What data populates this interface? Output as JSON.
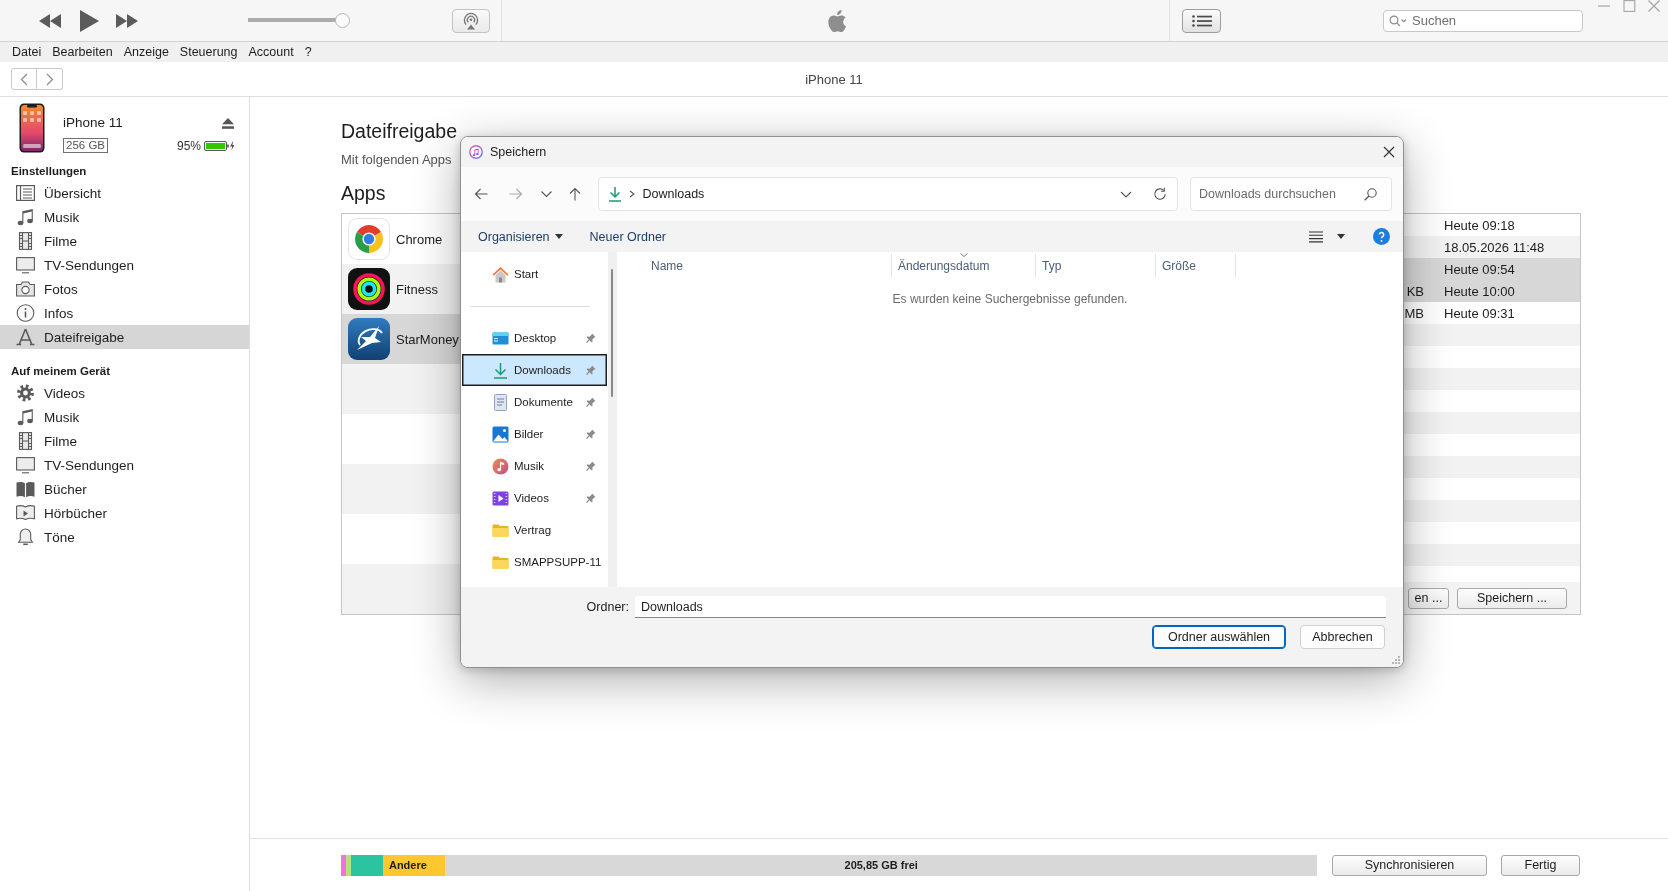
{
  "toolbar": {
    "volume": {
      "level": 0.94
    },
    "search": {
      "placeholder": "Suchen"
    }
  },
  "menu_bar": [
    "Datei",
    "Bearbeiten",
    "Anzeige",
    "Steuerung",
    "Account",
    "?"
  ],
  "nav_bar": {
    "title": "iPhone 11"
  },
  "device": {
    "name": "iPhone 11",
    "capacity": "256 GB",
    "battery": "95%"
  },
  "sidebar": {
    "sections": [
      {
        "heading": "Einstellungen",
        "items": [
          {
            "label": "Übersicht",
            "selected": false
          },
          {
            "label": "Musik",
            "selected": false
          },
          {
            "label": "Filme",
            "selected": false
          },
          {
            "label": "TV-Sendungen",
            "selected": false
          },
          {
            "label": "Fotos",
            "selected": false
          },
          {
            "label": "Infos",
            "selected": false
          },
          {
            "label": "Dateifreigabe",
            "selected": true
          }
        ]
      },
      {
        "heading": "Auf meinem Gerät",
        "items": [
          {
            "label": "Videos",
            "selected": false
          },
          {
            "label": "Musik",
            "selected": false
          },
          {
            "label": "Filme",
            "selected": false
          },
          {
            "label": "TV-Sendungen",
            "selected": false
          },
          {
            "label": "Bücher",
            "selected": false
          },
          {
            "label": "Hörbücher",
            "selected": false
          },
          {
            "label": "Töne",
            "selected": false
          }
        ]
      }
    ]
  },
  "file_sharing": {
    "title": "Dateifreigabe",
    "description": "Mit folgenden Apps",
    "apps_title": "Apps",
    "apps": [
      {
        "name": "Chrome",
        "selected": false
      },
      {
        "name": "Fitness",
        "selected": false
      },
      {
        "name": "StarMoney",
        "selected": true
      }
    ],
    "documents": [
      {
        "modified": "Heute 09:18",
        "selected": false
      },
      {
        "modified": "18.05.2026 11:48",
        "selected": false
      },
      {
        "modified": "Heute 09:54",
        "selected": true
      },
      {
        "size": "KB",
        "modified": "Heute 10:00",
        "selected": true
      },
      {
        "size": "MB",
        "modified": "Heute 09:31",
        "selected": false
      }
    ],
    "buttons": [
      "en ...",
      "Speichern ..."
    ]
  },
  "storage": {
    "segments": [
      {
        "color": "#f472de",
        "level": 0.005
      },
      {
        "color": "#b5e27d",
        "level": 0.005
      },
      {
        "color": "#2cc3a0",
        "level": 0.033
      },
      {
        "label": "Andere",
        "color": "#fdc82f",
        "level": 0.064
      }
    ],
    "free": "205,85 GB frei"
  },
  "footer_buttons": [
    "Synchronisieren",
    "Fertig"
  ],
  "dialog": {
    "title": "Speichern",
    "breadcrumb": "Downloads",
    "search": {
      "placeholder": "Downloads durchsuchen"
    },
    "commands": [
      {
        "label": "Organisieren",
        "kind": "menu"
      },
      {
        "label": "Neuer Ordner",
        "kind": "plain"
      }
    ],
    "nav_pane": {
      "groups": [
        {
          "items": [
            {
              "label": "Start",
              "pinned": false,
              "selected": false
            }
          ]
        },
        {
          "items": [
            {
              "label": "Desktop",
              "pinned": true,
              "selected": false
            },
            {
              "label": "Downloads",
              "pinned": true,
              "selected": true
            },
            {
              "label": "Dokumente",
              "pinned": true,
              "selected": false
            },
            {
              "label": "Bilder",
              "pinned": true,
              "selected": false
            },
            {
              "label": "Musik",
              "pinned": true,
              "selected": false
            },
            {
              "label": "Videos",
              "pinned": true,
              "selected": false
            },
            {
              "label": "Vertrag",
              "pinned": false,
              "selected": false
            },
            {
              "label": "SMAPPSUPP-11",
              "pinned": false,
              "selected": false
            }
          ]
        }
      ]
    },
    "columns": [
      {
        "label": "Name",
        "sorted": false
      },
      {
        "label": "Änderungsdatum",
        "sorted": true
      },
      {
        "label": "Typ",
        "sorted": false
      },
      {
        "label": "Größe",
        "sorted": false
      }
    ],
    "empty_message": "Es wurden keine Suchergebnisse gefunden.",
    "folder": {
      "label": "Ordner:",
      "value": "Downloads"
    },
    "buttons": [
      {
        "label": "Ordner auswählen",
        "default": true
      },
      {
        "label": "Abbrechen",
        "default": false
      }
    ]
  }
}
